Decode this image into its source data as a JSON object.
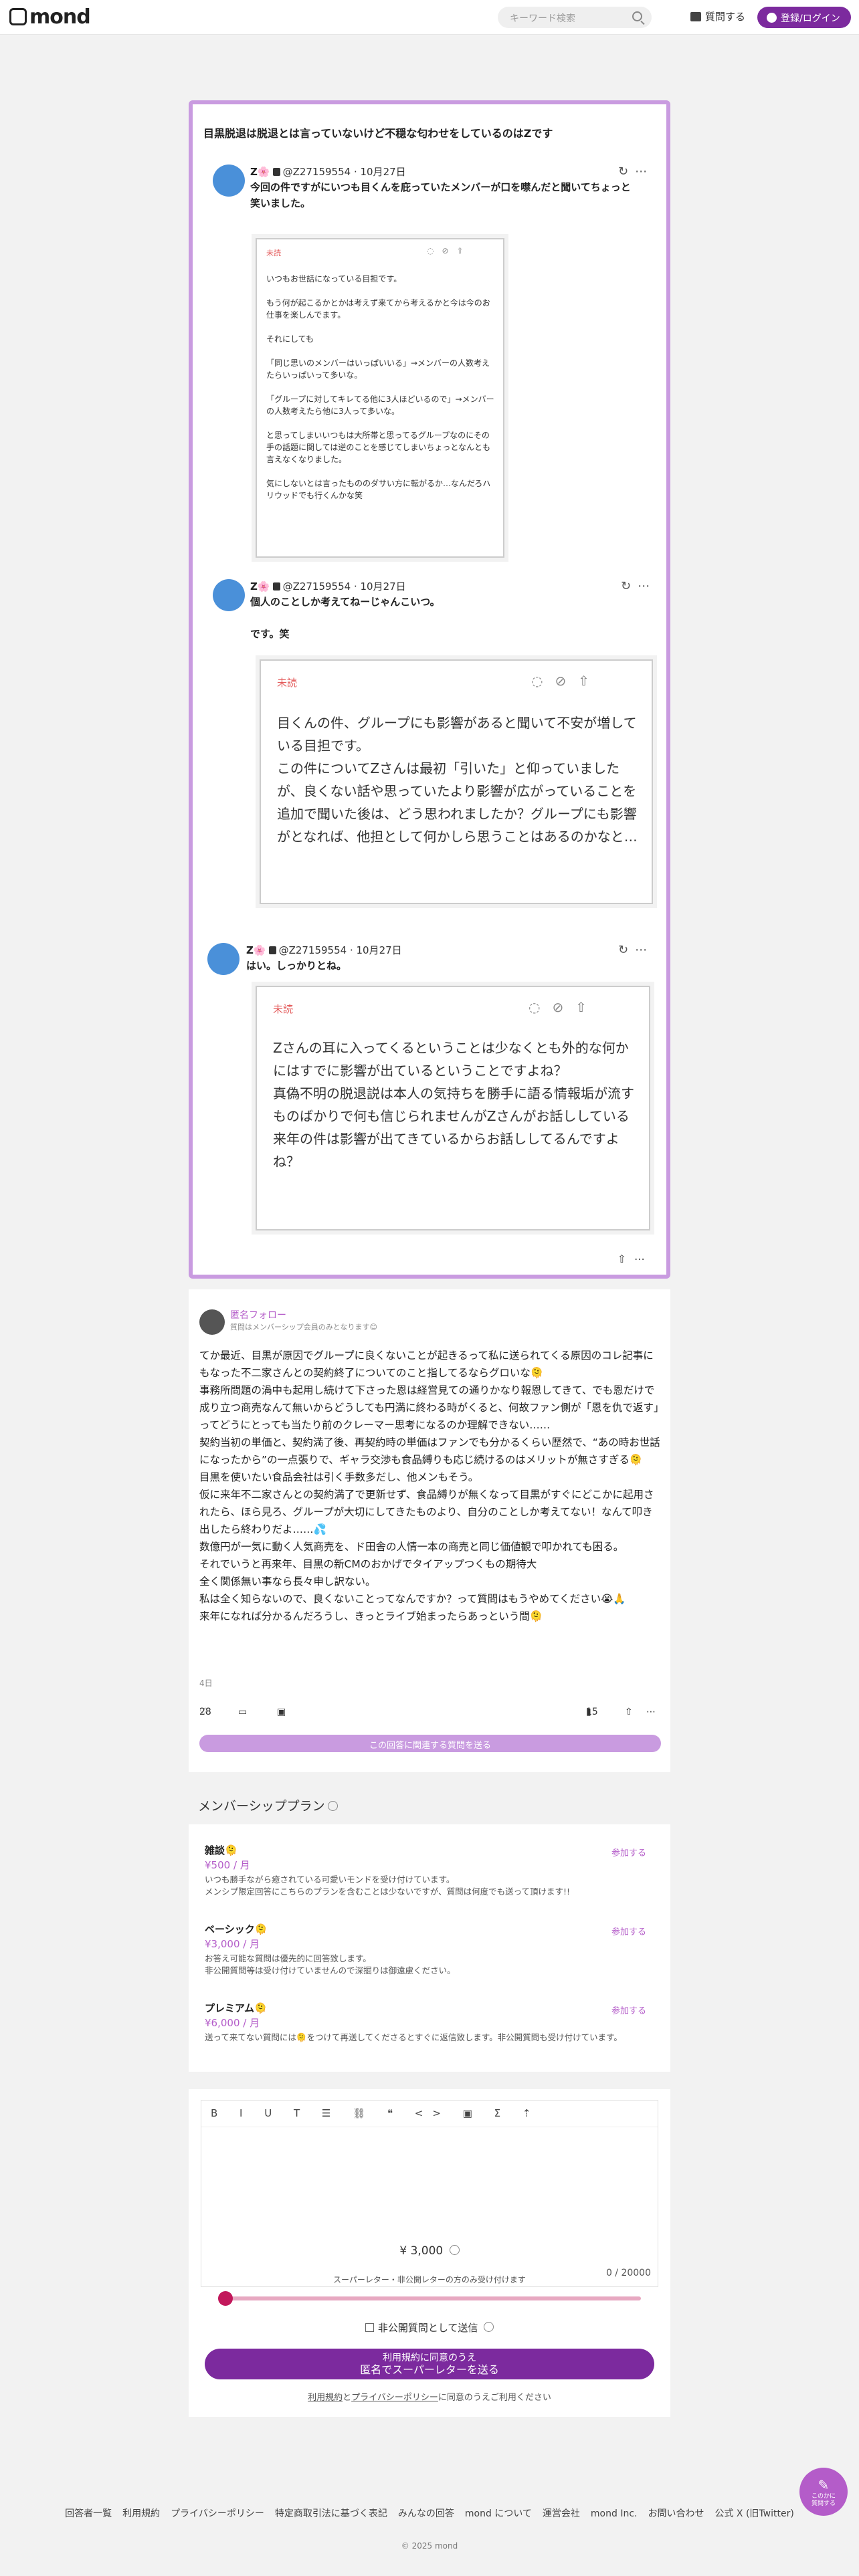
{
  "header": {
    "logo": "mond",
    "search_placeholder": "キーワード検索",
    "ask_label": "質問する",
    "login_label": "登録/ログイン"
  },
  "question": {
    "title": "目黒脱退は脱退とは言っていないけど不穏な匂わせをしているのはZです",
    "posts": [
      {
        "user": "Z🌸",
        "handle": "@Z27159554",
        "date": "10月27日",
        "text": "今回の件ですがにいつも目くんを庇っていたメンバーが口を噤んだと聞いてちょっと笑いました。",
        "letter_unread": "未読",
        "letter_text": "いつもお世話になっている目担です。\n\nもう何が起こるかとかは考えず来てから考えるかと今は今のお仕事を楽しんでます。\n\nそれにしても\n\n「同じ思いのメンバーはいっぱいいる」→メンバーの人数考えたらいっぱいって多いな。\n\n「グループに対してキレてる他に3人ほどいるので」→メンバーの人数考えたら他に3人って多いな。\n\nと思ってしまいいつもは大所帯と思ってるグループなのにその手の話題に関しては逆のことを感じてしまいちょっとなんとも言えなくなりました。\n\n気にしないとは言ったもののダサい方に転がるか…なんだろハリウッドでも行くんかな笑"
      },
      {
        "user": "Z🌸",
        "handle": "@Z27159554",
        "date": "10月27日",
        "text": "個人のことしか考えてねーじゃんこいつ。\n\nです。笑",
        "letter_unread": "未読",
        "letter_text": "目くんの件、グループにも影響があると聞いて不安が増している目担です。\nこの件についてZさんは最初「引いた」と仰っていましたが、良くない話や思っていたより影響が広がっていることを追加で聞いた後は、どう思われましたか？グループにも影響がとなれば、他担として何かしら思うことはあるのかなと…"
      },
      {
        "user": "Z🌸",
        "handle": "@Z27159554",
        "date": "10月27日",
        "text": "はい。しっかりとね。",
        "letter_unread": "未読",
        "letter_text": "Zさんの耳に入ってくるということは少なくとも外的な何かにはすでに影響が出ているということですよね？\n真偽不明の脱退説は本人の気持ちを勝手に語る情報垢が流すものばかりで何も信じられませんがZさんがお話ししている来年の件は影響が出てきているからお話ししてるんですよね？"
      }
    ]
  },
  "answer": {
    "name": "匿名フォロー",
    "sub": "質問はメンバーシップ会員のみとなります😊",
    "body": "てか最近、目黒が原因でグループに良くないことが起きるって私に送られてくる原因のコレ記事にもなった不二家さんとの契約終了についてのこと指してるならグロいな🫠\n事務所問題の渦中も起用し続けて下さった恩は経営見ての通りかなり報恩してきて、でも恩だけで成り立つ商売なんて無いからどうしても円満に終わる時がくると、何故ファン側が「恩を仇で返す」ってどうにとっても当たり前のクレーマー思考になるのか理解できない……\n契約当初の単価と、契約満了後、再契約時の単価はファンでも分かるくらい歴然で、“あの時お世話になったから”の一点張りで、ギャラ交渉も食品縛りも応じ続けるのはメリットが無さすぎる🫠\n目黒を使いたい食品会社は引く手数多だし、他メンもそう。\n仮に来年不二家さんとの契約満了で更新せず、食品縛りが無くなって目黒がすぐにどこかに起用されたら、ほら見ろ、グループが大切にしてきたものより、自分のことしか考えてない！なんて叩き出したら終わりだよ……💦\n数億円が一気に動く人気商売を、ド田舎の人情一本の商売と同じ価値観で叩かれても困る。\nそれでいうと再来年、目黒の新CMのおかげでタイアップつくもの期待大\n全く関係無い事なら長々申し訳ない。\n私は全く知らないので、良くないことってなんですか？って質問はもうやめてください😭🙏\n来年になれば分かるんだろうし、きっとライブ始まったらあっという間🫠",
    "time": "4日",
    "likes": "28",
    "bookmarks": "15",
    "send_question_label": "この回答に関連する質問を送る"
  },
  "membership": {
    "title": "メンバーシッププラン",
    "join_label": "参加する",
    "plans": [
      {
        "name": "雑談🫠",
        "price": "¥500 / 月",
        "desc": "いつも勝手ながら癒されている可愛いモンドを受け付けています。\nメンシプ限定回答にこちらのプランを含むことは少ないですが、質問は何度でも送って頂けます!!"
      },
      {
        "name": "ベーシック🫠",
        "price": "¥3,000 / 月",
        "desc": "お答え可能な質問は優先的に回答致します。\n非公開質問等は受け付けていませんので深掘りは御遠慮ください。"
      },
      {
        "name": "プレミアム🫠",
        "price": "¥6,000 / 月",
        "desc": "送って来てない質問には🫠をつけて再送してくださるとすぐに返信致します。非公開質問も受け付けています。"
      }
    ]
  },
  "editor": {
    "toolbar": "B I U T ☰ ⛓ ❝ <> ▣ Σ ⇡",
    "count": "0 / 20000",
    "amount": "¥  3,000",
    "slider_note": "スーパーレター・非公開レターの方のみ受け付けます",
    "slider_fraction": 0.0,
    "private_label": "非公開質問として送信",
    "send_line1": "利用規約に同意のうえ",
    "send_line2": "匿名でスーパーレターを送る",
    "terms_a": "利用規約",
    "terms_mid": "と",
    "terms_b": "プライバシーポリシー",
    "terms_end": "に同意のうえご利用ください"
  },
  "fab": {
    "line1": "このかに",
    "line2": "質問する"
  },
  "footer": {
    "links": [
      "回答者一覧",
      "利用規約",
      "プライバシーポリシー",
      "特定商取引法に基づく表記",
      "みんなの回答",
      "mond について",
      "運営会社",
      "mond Inc.",
      "お問い合わせ",
      "公式 X (旧Twitter)"
    ],
    "copyright": "© 2025 mond"
  }
}
